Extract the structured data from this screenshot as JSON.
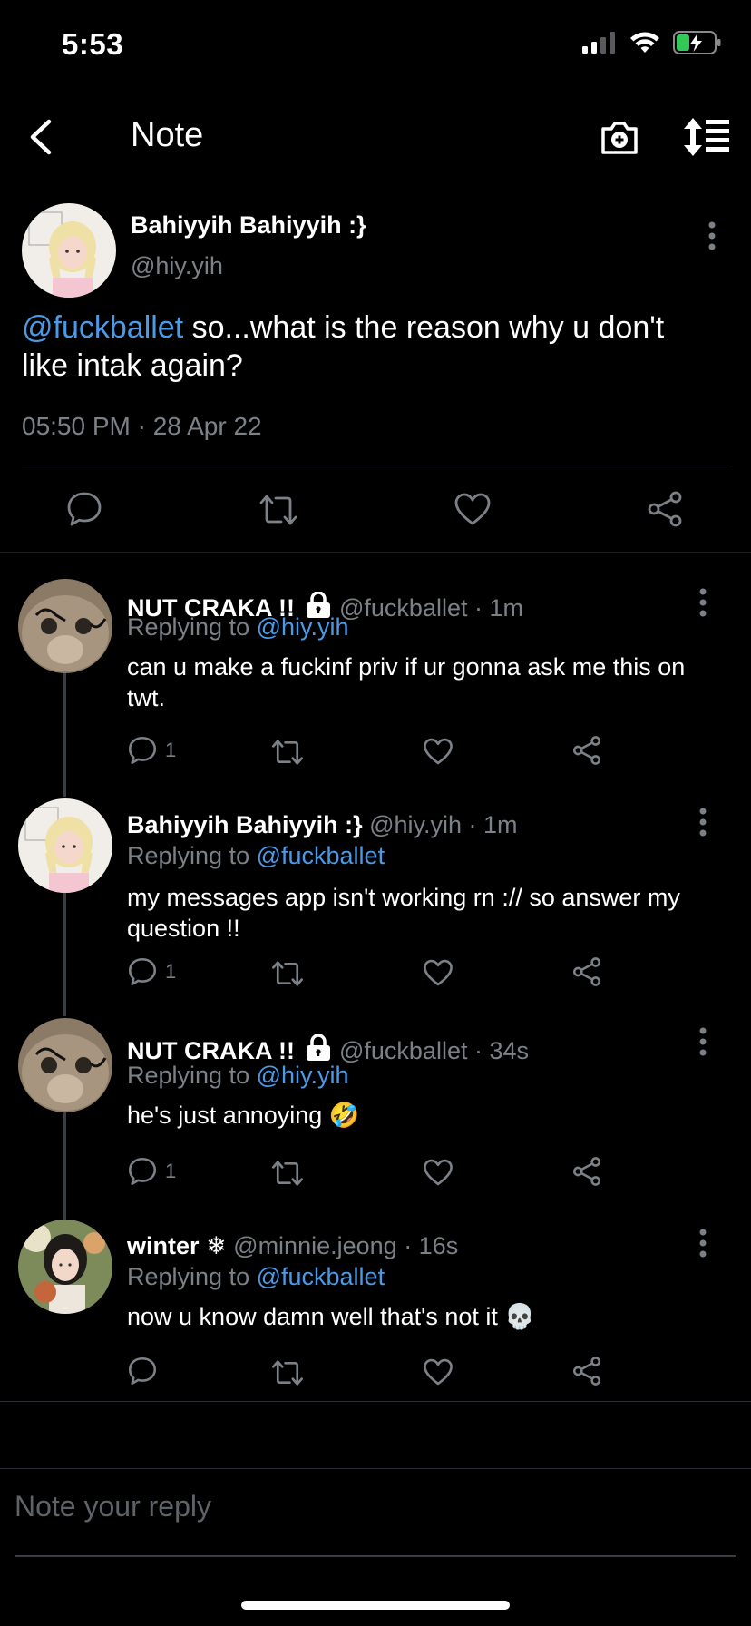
{
  "status_bar": {
    "time": "5:53"
  },
  "nav": {
    "title": "Note"
  },
  "main_tweet": {
    "name": "Bahiyyih Bahiyyih :}",
    "handle": "@hiy.yih",
    "mention": "@fuckballet",
    "text": " so...what is the reason why u don't like intak again?",
    "timestamp": "05:50 PM · 28 Apr 22"
  },
  "replies": [
    {
      "name": "NUT CRAKA !!",
      "locked": true,
      "handle": "@fuckballet",
      "time": "· 1m",
      "replying_prefix": "Replying to ",
      "replying_to": "@hiy.yih",
      "text": "can u make a fuckinf priv if ur gonna ask me this on twt.",
      "reply_count": "1",
      "avatar": "cat"
    },
    {
      "name": "Bahiyyih Bahiyyih :}",
      "locked": false,
      "handle": "@hiy.yih",
      "time": "· 1m",
      "replying_prefix": "Replying to ",
      "replying_to": "@fuckballet",
      "text": "my messages app isn't working rn :// so answer my question !!",
      "reply_count": "1",
      "avatar": "blonde"
    },
    {
      "name": "NUT CRAKA !!",
      "locked": true,
      "handle": "@fuckballet",
      "time": "· 34s",
      "replying_prefix": "Replying to ",
      "replying_to": "@hiy.yih",
      "text": "he's just annoying 🤣",
      "reply_count": "1",
      "avatar": "cat"
    },
    {
      "name": "winter ❄",
      "locked": false,
      "handle": "@minnie.jeong",
      "time": "· 16s",
      "replying_prefix": "Replying to ",
      "replying_to": "@fuckballet",
      "text": "now u know damn well that's not it 💀",
      "reply_count": "",
      "avatar": "winter"
    }
  ],
  "reply_box": {
    "placeholder": "Note your reply"
  },
  "colors": {
    "background": "#000000",
    "link": "#4a9ae8",
    "muted": "#7c8187",
    "battery": "#34c759"
  },
  "icons": [
    "back-icon",
    "camera-icon",
    "sort-icon",
    "more-icon",
    "comment-icon",
    "retweet-icon",
    "heart-icon",
    "share-icon",
    "lock-icon"
  ]
}
